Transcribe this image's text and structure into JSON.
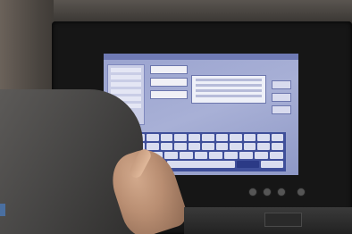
{
  "app": {
    "window_title": "",
    "status_text": ""
  },
  "form": {
    "fields": [
      {
        "label": "",
        "value": ""
      },
      {
        "label": "",
        "value": ""
      },
      {
        "label": "",
        "value": ""
      }
    ],
    "preview_text": ""
  },
  "side_buttons": [
    {
      "label": ""
    },
    {
      "label": ""
    },
    {
      "label": ""
    }
  ],
  "keyboard": {
    "rows": [
      [
        "",
        "",
        "",
        "",
        "",
        "",
        "",
        "",
        "",
        "",
        "",
        ""
      ],
      [
        "",
        "",
        "",
        "",
        "",
        "",
        "",
        "",
        "",
        "",
        "",
        ""
      ],
      [
        "",
        "",
        "",
        "",
        "",
        "",
        "",
        "",
        "",
        "",
        ""
      ],
      [
        "",
        "",
        "",
        "",
        ""
      ]
    ]
  },
  "colors": {
    "screen_bg": "#a8b0d6",
    "keyboard_bg": "#3f4f9a",
    "key_bg": "#d9ddf0"
  }
}
